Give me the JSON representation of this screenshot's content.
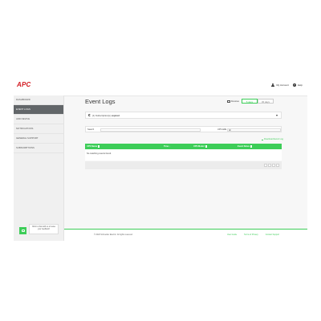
{
  "header": {
    "logo_text": "APC",
    "account_label": "My Account",
    "help_label": "Help"
  },
  "sidebar": {
    "items": [
      {
        "label": "Dashboard"
      },
      {
        "label": "Event Logs"
      },
      {
        "label": "Add Device"
      },
      {
        "label": "Notifications"
      },
      {
        "label": "General Support"
      },
      {
        "label": "Subscriptions"
      }
    ]
  },
  "main": {
    "title": "Event Logs",
    "view_label": "Devices",
    "seg_active": "5 days",
    "seg_inactive": "30 days",
    "update_text": "(1) Subscription(s)",
    "update_text_bold": "expired",
    "filter": {
      "search_label": "Search",
      "search_placeholder": "",
      "ups_label": "UPS ARE",
      "ups_value": "All"
    },
    "export_label": "Download Event Log",
    "table": {
      "columns": [
        "UPS Name",
        "Time ↓",
        "UPS Model",
        "Event Notes"
      ],
      "empty_text": "No matching events found."
    }
  },
  "chat": {
    "message": "Click to chat with us or leave your feedback!"
  },
  "footer": {
    "copyright": "© 2020 Schneider Electric. All rights reserved.",
    "links": [
      "User Guide",
      "Terms of Privacy",
      "Contact Support"
    ]
  },
  "colors": {
    "accent": "#3dcd58",
    "brand": "#d2171e",
    "nav_active": "#626669"
  }
}
